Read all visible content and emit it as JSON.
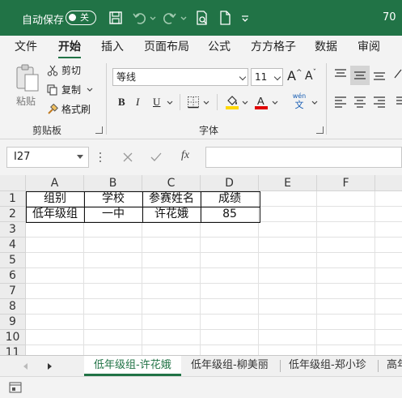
{
  "titlebar": {
    "autosave_label": "自动保存",
    "autosave_state": "关",
    "zoom_text": "70"
  },
  "menu_tabs": [
    "文件",
    "开始",
    "插入",
    "页面布局",
    "公式",
    "方方格子",
    "数据",
    "审阅"
  ],
  "active_tab": "开始",
  "ribbon": {
    "paste_label": "粘贴",
    "cut_label": "剪切",
    "copy_label": "复制",
    "format_painter_label": "格式刷",
    "clipboard_group": "剪贴板",
    "font_name": "等线",
    "font_size": "11",
    "font_group": "字体",
    "bold": "B",
    "italic": "I",
    "underline": "U",
    "grow_font": "A",
    "shrink_font": "A",
    "wen_top": "wén",
    "wen_bottom": "文",
    "font_color": "#e00000",
    "fill_color": "#ffd800"
  },
  "formula_bar": {
    "cell_ref": "I27",
    "fx": "fx",
    "formula": ""
  },
  "grid": {
    "columns": [
      "A",
      "B",
      "C",
      "D",
      "E",
      "F"
    ],
    "rows": [
      "1",
      "2",
      "3",
      "4",
      "5",
      "6",
      "7",
      "8",
      "9",
      "10",
      "11"
    ],
    "cells": {
      "A1": "组别",
      "B1": "学校",
      "C1": "参赛姓名",
      "D1": "成绩",
      "A2": "低年级组",
      "B2": "一中",
      "C2": "许花娥",
      "D2": "85"
    }
  },
  "sheets": [
    "低年级组-许花娥",
    "低年级组-柳美丽",
    "低年级组-郑小珍",
    "高年"
  ],
  "active_sheet": "低年级组-许花娥",
  "accent_color": "#217346"
}
